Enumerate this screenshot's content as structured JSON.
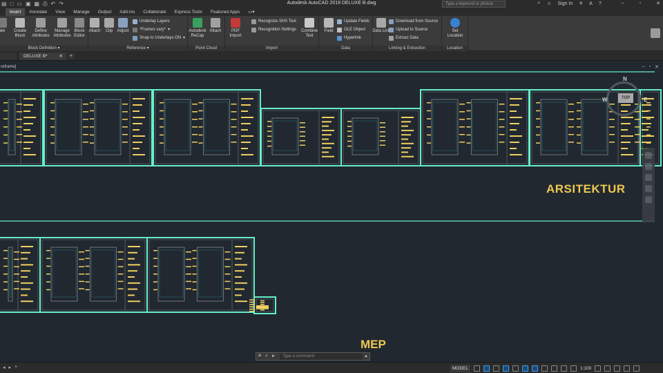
{
  "window": {
    "title": "Autodesk AutoCAD 2019   DELUXE B.dwg",
    "search_placeholder": "Type a keyword or phrase",
    "sign_in": "Sign In"
  },
  "ribbon_tabs": [
    "Insert",
    "Annotate",
    "View",
    "Manage",
    "Output",
    "Add-ins",
    "Collaborate",
    "Express Tools",
    "Featured Apps"
  ],
  "active_tab": "Insert",
  "ribbon": {
    "block_definition": {
      "label": "Block Definition ▾",
      "create_block": "Create Block",
      "define_attributes": "Define Attributes",
      "manage_attributes": "Manage Attributes",
      "block_editor": "Block Editor"
    },
    "reference": {
      "label": "Reference ▾",
      "attach": "Attach",
      "clip": "Clip",
      "adjust": "Adjust",
      "underlay_layers": "Underlay Layers",
      "frames_vary": "*Frames vary*",
      "snap_underlays": "Snap to Underlays ON"
    },
    "point_cloud": {
      "label": "Point Cloud",
      "recap": "Autodesk ReCap",
      "attach": "Attach"
    },
    "import": {
      "label": "Import",
      "pdf_import": "PDF Import",
      "recognize_shx": "Recognize SHX Text",
      "recognition_settings": "Recognition Settings",
      "combine_text": "Combine Text"
    },
    "data": {
      "label": "Data",
      "field": "Field",
      "update_fields": "Update Fields",
      "ole_object": "OLE Object",
      "hyperlink": "Hyperlink"
    },
    "linking": {
      "label": "Linking & Extraction",
      "data_link": "Data Link",
      "download_from_source": "Download from Source",
      "upload_to_source": "Upload to Source",
      "extract_data": "Extract  Data"
    },
    "location": {
      "label": "Location",
      "set_location": "Set Location"
    }
  },
  "file_tabs": {
    "active": "DELUXE B*"
  },
  "viewport": {
    "view_label": "reframe]",
    "section_arsitektur": "ARSITEKTUR",
    "section_mep": "MEP"
  },
  "viewcube": {
    "top": "TOP",
    "north": "N",
    "west": "W",
    "east": "E"
  },
  "command": {
    "placeholder": "Type a command"
  },
  "status": {
    "model": "MODEL",
    "scale": "1:100"
  },
  "colors": {
    "sheet_border": "#66f0c8",
    "drawing_yellow": "#f0d060",
    "section_label": "#f0c850",
    "background": "#212830"
  }
}
